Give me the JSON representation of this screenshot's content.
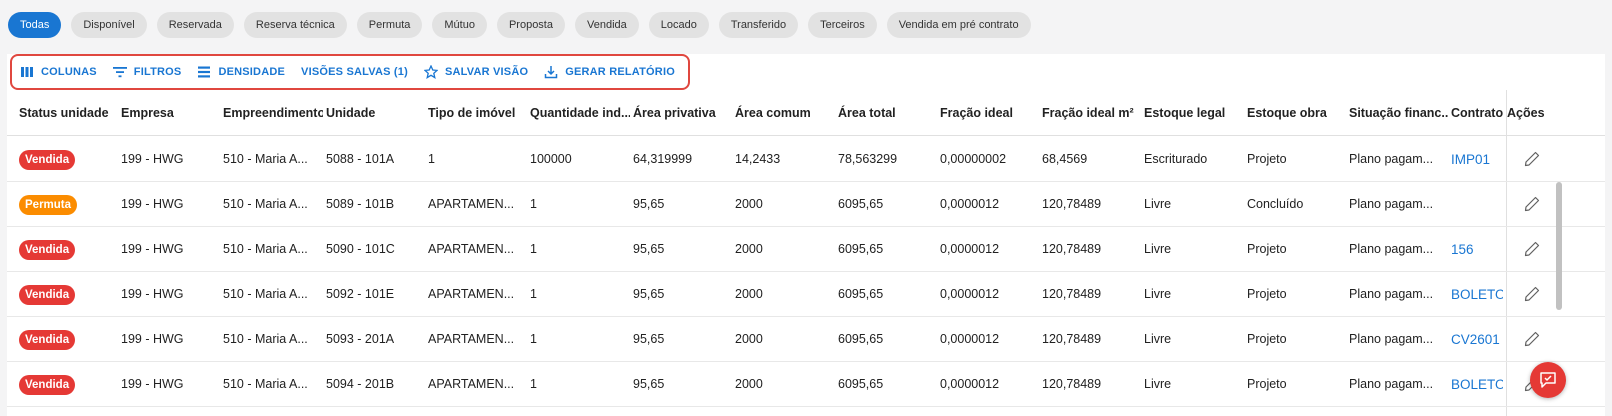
{
  "status_chips": [
    "Todas",
    "Disponível",
    "Reservada",
    "Reserva técnica",
    "Permuta",
    "Mútuo",
    "Proposta",
    "Vendida",
    "Locado",
    "Transferido",
    "Terceiros",
    "Vendida em pré contrato"
  ],
  "toolbar": {
    "colunas": "COLUNAS",
    "filtros": "FILTROS",
    "densidade": "DENSIDADE",
    "visoes_salvas": "VISÕES SALVAS (1)",
    "salvar_visao": "SALVAR VISÃO",
    "gerar_relatorio": "GERAR RELATÓRIO"
  },
  "columns": [
    "Status unidade",
    "Empresa",
    "Empreendimento",
    "Unidade",
    "Tipo de imóvel",
    "Quantidade ind...",
    "Área privativa",
    "Área comum",
    "Área total",
    "Fração ideal",
    "Fração ideal m²",
    "Estoque legal",
    "Estoque obra",
    "Situação financ...",
    "Contrato",
    "Ações"
  ],
  "rows": [
    {
      "status": "Vendida",
      "status_kind": "vendida",
      "empresa": "199 - HWG",
      "empreendimento": "510 - Maria A...",
      "unidade": "5088 - 101A",
      "tipo": "1",
      "quantidade": "100000",
      "area_privativa": "64,319999",
      "area_comum": "14,2433",
      "area_total": "78,563299",
      "fracao": "0,00000002",
      "fracao_m2": "68,4569",
      "estoque_legal": "Escriturado",
      "estoque_obra": "Projeto",
      "situacao": "Plano pagam...",
      "contrato": "IMP01"
    },
    {
      "status": "Permuta",
      "status_kind": "permuta",
      "empresa": "199 - HWG",
      "empreendimento": "510 - Maria A...",
      "unidade": "5089 - 101B",
      "tipo": "APARTAMEN...",
      "quantidade": "1",
      "area_privativa": "95,65",
      "area_comum": "2000",
      "area_total": "6095,65",
      "fracao": "0,0000012",
      "fracao_m2": "120,78489",
      "estoque_legal": "Livre",
      "estoque_obra": "Concluído",
      "situacao": "Plano pagam...",
      "contrato": ""
    },
    {
      "status": "Vendida",
      "status_kind": "vendida",
      "empresa": "199 - HWG",
      "empreendimento": "510 - Maria A...",
      "unidade": "5090 - 101C",
      "tipo": "APARTAMEN...",
      "quantidade": "1",
      "area_privativa": "95,65",
      "area_comum": "2000",
      "area_total": "6095,65",
      "fracao": "0,0000012",
      "fracao_m2": "120,78489",
      "estoque_legal": "Livre",
      "estoque_obra": "Projeto",
      "situacao": "Plano pagam...",
      "contrato": "156"
    },
    {
      "status": "Vendida",
      "status_kind": "vendida",
      "empresa": "199 - HWG",
      "empreendimento": "510 - Maria A...",
      "unidade": "5092 - 101E",
      "tipo": "APARTAMEN...",
      "quantidade": "1",
      "area_privativa": "95,65",
      "area_comum": "2000",
      "area_total": "6095,65",
      "fracao": "0,0000012",
      "fracao_m2": "120,78489",
      "estoque_legal": "Livre",
      "estoque_obra": "Projeto",
      "situacao": "Plano pagam...",
      "contrato": "BOLETO"
    },
    {
      "status": "Vendida",
      "status_kind": "vendida",
      "empresa": "199 - HWG",
      "empreendimento": "510 - Maria A...",
      "unidade": "5093 - 201A",
      "tipo": "APARTAMEN...",
      "quantidade": "1",
      "area_privativa": "95,65",
      "area_comum": "2000",
      "area_total": "6095,65",
      "fracao": "0,0000012",
      "fracao_m2": "120,78489",
      "estoque_legal": "Livre",
      "estoque_obra": "Projeto",
      "situacao": "Plano pagam...",
      "contrato": "CV2601"
    },
    {
      "status": "Vendida",
      "status_kind": "vendida",
      "empresa": "199 - HWG",
      "empreendimento": "510 - Maria A...",
      "unidade": "5094 - 201B",
      "tipo": "APARTAMEN...",
      "quantidade": "1",
      "area_privativa": "95,65",
      "area_comum": "2000",
      "area_total": "6095,65",
      "fracao": "0,0000012",
      "fracao_m2": "120,78489",
      "estoque_legal": "Livre",
      "estoque_obra": "Projeto",
      "situacao": "Plano pagam...",
      "contrato": "BOLETO"
    }
  ],
  "icons": {
    "edit": "pencil-icon",
    "feedback": "chat-feedback-icon"
  },
  "colors": {
    "primary": "#1976d2",
    "vendida": "#e53935",
    "permuta": "#fb8c00",
    "highlight": "#e0473f"
  }
}
